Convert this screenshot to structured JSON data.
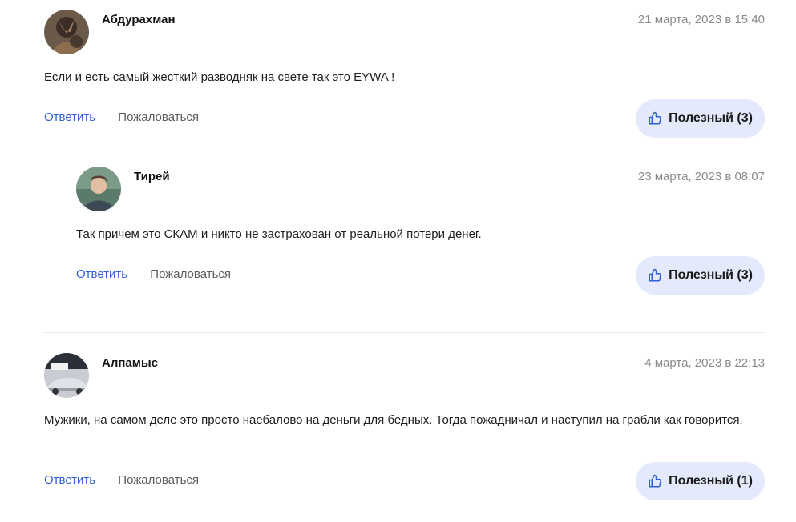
{
  "comments": [
    {
      "author": "Абдурахман",
      "date": "21 марта, 2023 в 15:40",
      "text": "Если и есть самый жесткий разводняк на свете так это EYWA !",
      "reply_label": "Ответить",
      "report_label": "Пожаловаться",
      "useful_label": "Полезный (3)"
    },
    {
      "author": "Тирей",
      "date": "23 марта, 2023 в 08:07",
      "text": "Так причем это СКАМ и никто не застрахован от реальной потери денег.",
      "reply_label": "Ответить",
      "report_label": "Пожаловаться",
      "useful_label": "Полезный (3)"
    },
    {
      "author": "Алпамыс",
      "date": "4 марта, 2023 в 22:13",
      "text": "Мужики, на самом деле это просто наебалово на деньги для бедных. Тогда пожадничал и наступил на грабли как говорится.",
      "reply_label": "Ответить",
      "report_label": "Пожаловаться",
      "useful_label": "Полезный (1)"
    }
  ],
  "icons": {
    "useful": "thumbs-up-icon"
  },
  "colors": {
    "accent": "#2f5fd7",
    "button_bg": "#e4eafc",
    "muted": "#8a8a8a"
  }
}
